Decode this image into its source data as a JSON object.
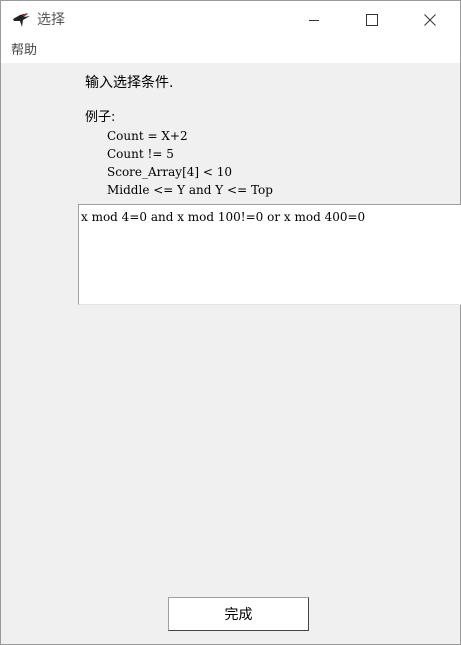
{
  "window": {
    "title": "选择",
    "icon": "app-bird-icon",
    "controls": {
      "minimize": "minimize-icon",
      "maximize": "maximize-icon",
      "close": "close-icon"
    }
  },
  "menubar": {
    "items": [
      {
        "label": "帮助"
      }
    ]
  },
  "dialog": {
    "prompt": "输入选择条件.",
    "examples_heading": "例子:",
    "examples": [
      "Count = X+2",
      "Count != 5",
      "Score_Array[4] < 10",
      "Middle <= Y and Y <= Top"
    ],
    "condition_value": "x mod 4=0 and x mod 100!=0 or x mod 400=0",
    "done_label": "完成"
  }
}
